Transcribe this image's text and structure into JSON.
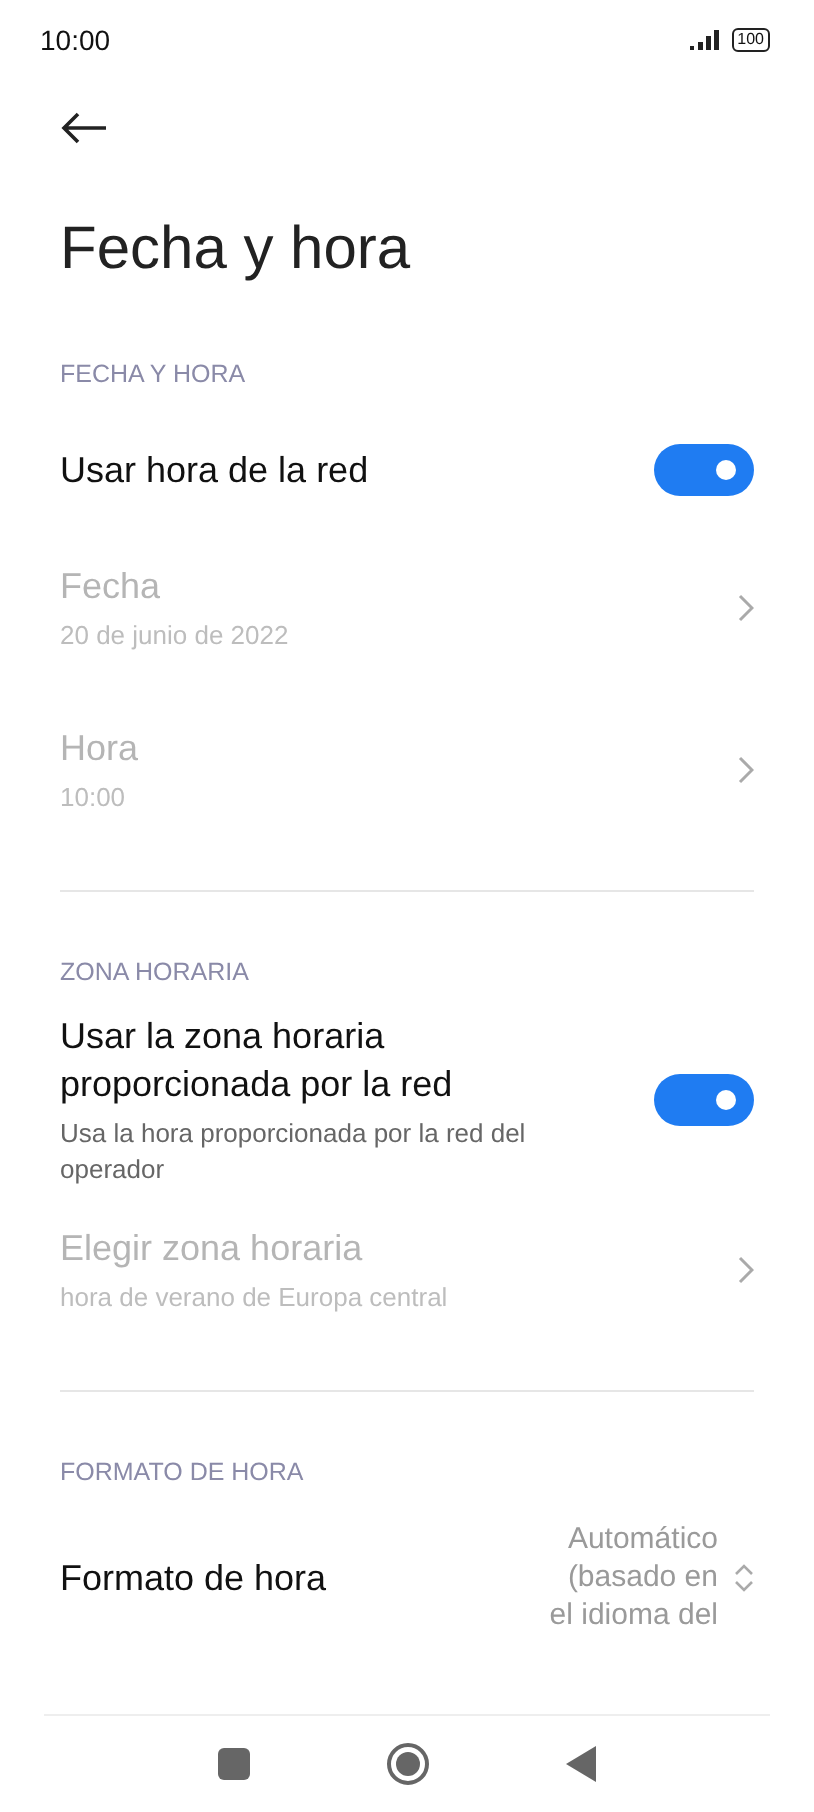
{
  "status_bar": {
    "time": "10:00",
    "battery": "100"
  },
  "title": "Fecha y hora",
  "sections": [
    {
      "header": "FECHA Y HORA",
      "divider": true,
      "items": [
        {
          "kind": "toggle",
          "label": "Usar hora de la red",
          "on": true,
          "disabled": false
        },
        {
          "kind": "link",
          "label": "Fecha",
          "value": "20 de junio de 2022",
          "disabled": true
        },
        {
          "kind": "link",
          "label": "Hora",
          "value": "10:00",
          "disabled": true
        }
      ]
    },
    {
      "header": "ZONA HORARIA",
      "divider": true,
      "items": [
        {
          "kind": "toggle",
          "label": "Usar la zona horaria proporcionada por la red",
          "value": "Usa la hora proporcionada por la red del operador",
          "on": true,
          "disabled": false
        },
        {
          "kind": "link",
          "label": "Elegir zona horaria",
          "value": "hora de verano de Europa central",
          "disabled": true
        }
      ]
    },
    {
      "header": "FORMATO DE HORA",
      "divider": false,
      "items": [
        {
          "kind": "dropdown",
          "label": "Formato de hora",
          "value": "Automático (basado en el idioma del",
          "disabled": false
        }
      ]
    }
  ]
}
